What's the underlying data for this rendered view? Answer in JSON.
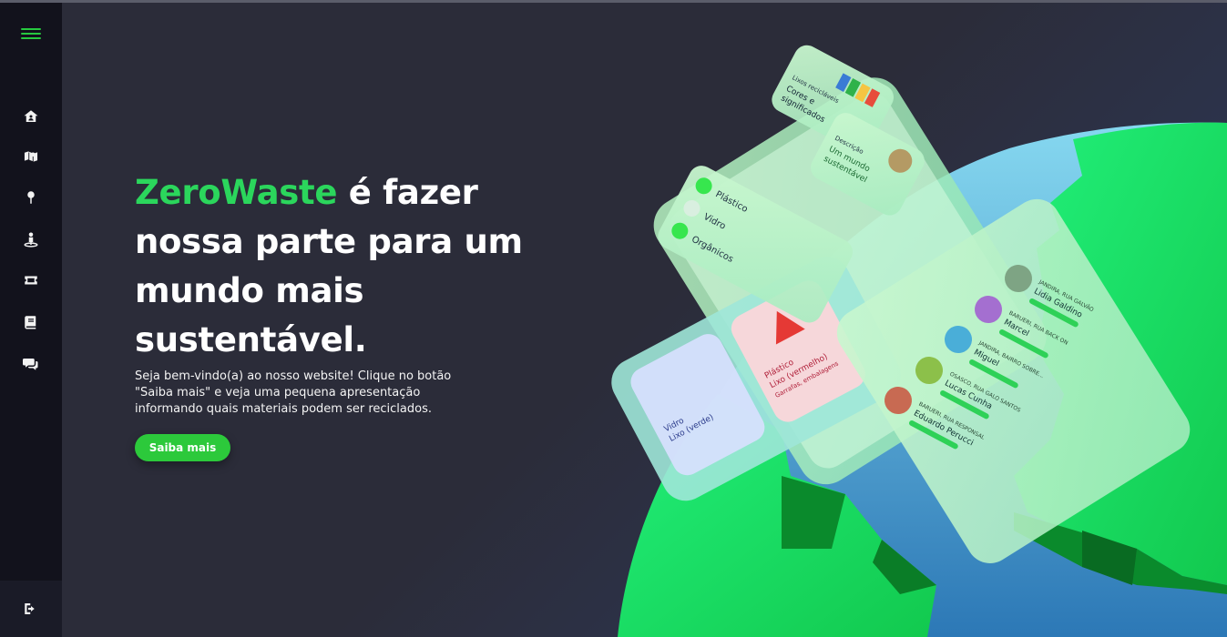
{
  "hero": {
    "brand": "ZeroWaste",
    "headline_rest_line1": " é fazer",
    "headline_line2": "nossa parte para um",
    "headline_line3": "mundo mais",
    "headline_line4": "sustentável.",
    "subtext_line1": "Seja bem-vindo(a) ao nosso website! Clique no botão",
    "subtext_line2": "\"Saiba mais\" e veja uma pequena apresentação",
    "subtext_line3": "informando quais materiais podem ser reciclados.",
    "cta_label": "Saiba mais"
  },
  "sidebar": {
    "items": [
      {
        "icon": "home-icon"
      },
      {
        "icon": "map-icon"
      },
      {
        "icon": "map-pin-icon"
      },
      {
        "icon": "location-person-icon"
      },
      {
        "icon": "ticket-icon"
      },
      {
        "icon": "book-icon"
      },
      {
        "icon": "chat-icon"
      }
    ],
    "logout_icon": "logout-icon"
  },
  "illustration": {
    "card_top_line1": "Lixos recicláveis",
    "card_top_line2": "Cores e",
    "card_top_line3": "significados",
    "card_tip_line1": "Descrição",
    "card_tip_line2": "Um mundo",
    "card_tip_line3": "sustentável",
    "list_items": [
      "Plástico",
      "Vidro",
      "Orgânicos"
    ],
    "bin_glass_line1": "Vidro",
    "bin_glass_line2": "Lixo (verde)",
    "bin_plastic_line1": "Plástico",
    "bin_plastic_line2": "Lixo (vermelho)",
    "bin_plastic_line3": "Garrafas, embalagens",
    "people": [
      {
        "area": "JANDIRA, RUA GALVÃO",
        "name": "Lidia Galdino"
      },
      {
        "area": "BARUERI, RUA BACK ON",
        "name": "Marcel"
      },
      {
        "area": "JANDIRA, BAIRRO SOBRE...",
        "name": "Miguel"
      },
      {
        "area": "OSASCO, RUA GALO SANTOS",
        "name": "Lucas Cunha"
      },
      {
        "area": "BARUERI, RUA RESPONSAL",
        "name": "Eduardo Perucci"
      }
    ]
  }
}
